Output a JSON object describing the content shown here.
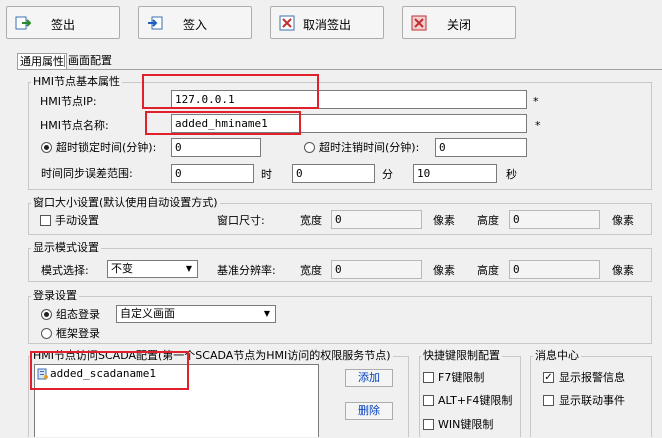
{
  "toolbar": {
    "checkout": "签出",
    "checkin": "签入",
    "cancel_checkout": "取消签出",
    "close": "关闭"
  },
  "tabs": [
    "通用属性",
    "画面配置"
  ],
  "basic": {
    "title": "HMI节点基本属性",
    "ip_label": "HMI节点IP:",
    "ip_value": "127.0.0.1",
    "name_label": "HMI节点名称:",
    "name_value": "added_hminame1",
    "required_mark": "*",
    "lock_label": "超时锁定时间(分钟):",
    "lock_value": "0",
    "logout_label": "超时注销时间(分钟):",
    "logout_value": "0",
    "sync_label": "时间同步误差范围:",
    "sync_hour": "0",
    "hour_unit": "时",
    "sync_min": "0",
    "min_unit": "分",
    "sync_sec": "10",
    "sec_unit": "秒"
  },
  "window_size": {
    "title": "窗口大小设置(默认使用自动设置方式)",
    "manual_label": "手动设置",
    "size_label": "窗口尺寸:",
    "width_label": "宽度",
    "width_value": "0",
    "px1": "像素",
    "height_label": "高度",
    "height_value": "0",
    "px2": "像素"
  },
  "display_mode": {
    "title": "显示模式设置",
    "mode_label": "模式选择:",
    "mode_value": "不变",
    "base_label": "基准分辨率:",
    "width_label": "宽度",
    "width_value": "0",
    "px1": "像素",
    "height_label": "高度",
    "height_value": "0",
    "px2": "像素"
  },
  "login": {
    "title": "登录设置",
    "group_login": "组态登录",
    "frame_login": "框架登录",
    "screen_value": "自定义画面"
  },
  "scada": {
    "title": "HMI节点访问SCADA配置(第一个SCADA节点为HMI访问的权限服务节点)",
    "item": "added_scadaname1",
    "add": "添加",
    "delete": "删除"
  },
  "hotkeys": {
    "title": "快捷键限制配置",
    "f7": "F7键限制",
    "altf4": "ALT+F4键限制",
    "win": "WIN键限制"
  },
  "messages": {
    "title": "消息中心",
    "show_alarm": "显示报警信息",
    "show_link": "显示联动事件",
    "check": "✓"
  }
}
